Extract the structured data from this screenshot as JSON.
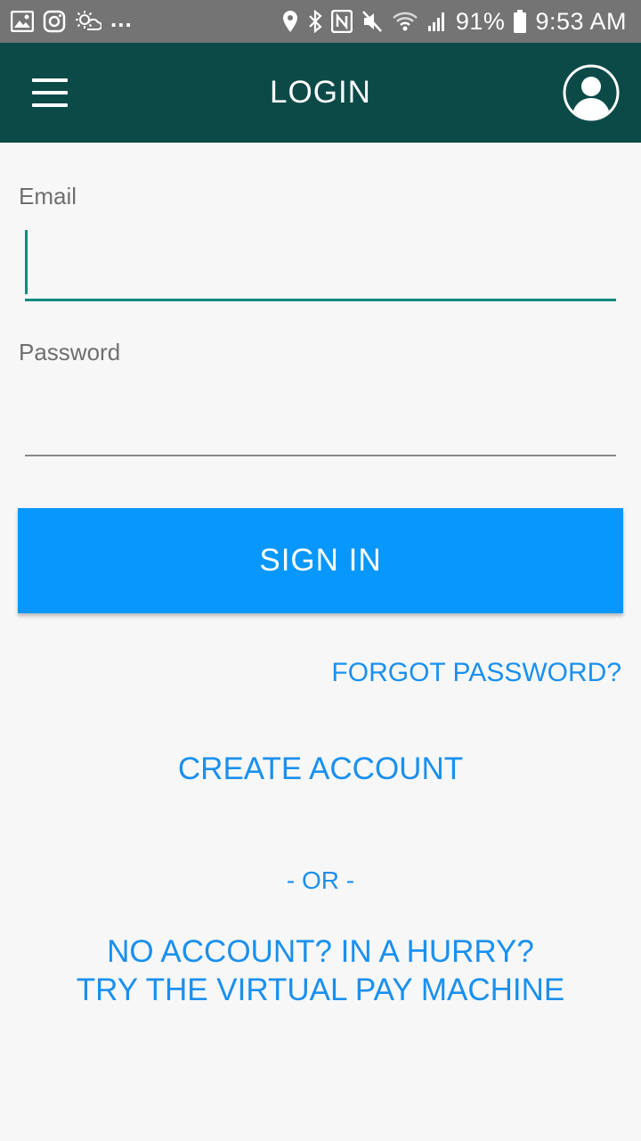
{
  "status_bar": {
    "battery": "91%",
    "time": "9:53 AM",
    "more": "...",
    "icons_left": [
      "gallery-icon",
      "instagram-icon",
      "weather-icon"
    ],
    "icons_right": [
      "location-icon",
      "bluetooth-icon",
      "nfc-icon",
      "mute-icon",
      "wifi-icon",
      "signal-icon",
      "battery-icon"
    ]
  },
  "app_bar": {
    "title": "LOGIN",
    "menu_icon": "hamburger-menu-icon",
    "profile_icon": "user-profile-icon"
  },
  "form": {
    "email_label": "Email",
    "email_value": "",
    "password_label": "Password",
    "password_value": ""
  },
  "actions": {
    "sign_in": "SIGN IN",
    "forgot_password": "FORGOT PASSWORD?",
    "create_account": "CREATE ACCOUNT",
    "or": "- OR -",
    "virtual_line1": "NO ACCOUNT? IN A HURRY?",
    "virtual_line2": "TRY THE VIRTUAL PAY MACHINE"
  },
  "colors": {
    "status_bar": "#747474",
    "app_bar": "#0c4a48",
    "accent": "#148a80",
    "primary_button": "#0897fc",
    "link": "#1a90ee",
    "background": "#f7f7f7"
  }
}
